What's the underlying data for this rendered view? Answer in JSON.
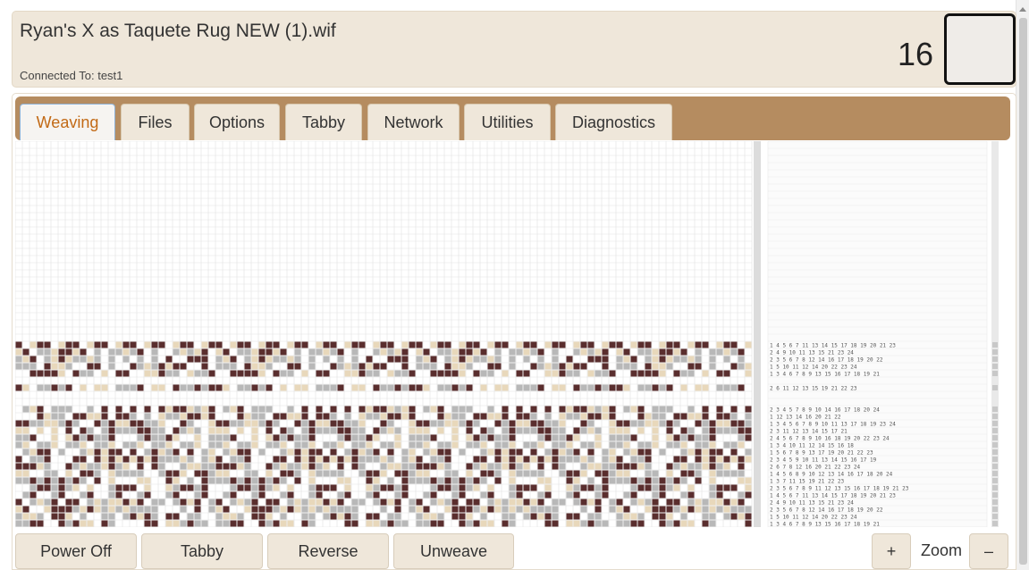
{
  "header": {
    "file_title": "Ryan's X as Taquete Rug NEW (1).wif",
    "connection": "Connected To: test1",
    "pick_counter": "16",
    "swatch_color": "#efece8"
  },
  "tabs": [
    {
      "label": "Weaving",
      "active": true
    },
    {
      "label": "Files",
      "active": false
    },
    {
      "label": "Options",
      "active": false
    },
    {
      "label": "Tabby",
      "active": false
    },
    {
      "label": "Network",
      "active": false
    },
    {
      "label": "Utilities",
      "active": false
    },
    {
      "label": "Diagnostics",
      "active": false
    }
  ],
  "footer": {
    "power_off": "Power Off",
    "tabby": "Tabby",
    "reverse": "Reverse",
    "unweave": "Unweave",
    "zoom_in": "+",
    "zoom_label": "Zoom",
    "zoom_out": "–"
  },
  "colors": {
    "accent": "#c26a16",
    "tabbar": "#b58c60",
    "panel": "#efe7da",
    "thread_dark": "#5a2e2e",
    "thread_tan": "#e8d8bb",
    "thread_gray": "#b8b8b8",
    "thread_white": "#ffffff"
  },
  "draft": {
    "rows": [
      {
        "lifts": "1  4 5 6 7  11  13 14 15  17 18 19 20 21  23"
      },
      {
        "lifts": "2  4  9 10 11  13  15  21  23 24"
      },
      {
        "lifts": "2 3  5 6 7 8  12  14  16 17 18 19 20  22"
      },
      {
        "lifts": "1  5  10 11 12  14  20  22 23 24"
      },
      {
        "lifts": "1  3 4  6 7 8 9  13  15 16 17 18 19  21"
      },
      {
        "lifts": "2  6  11 12 13  15  19  21 22 23"
      },
      {
        "lifts": "2 3 4 5  7 8 9 10  14  16 17 18  20  24"
      },
      {
        "lifts": "1  12 13 14  16  20 21 22"
      },
      {
        "lifts": "1  3 4 5 6 7 8 9 10 11  13  17 18 19  23 24"
      },
      {
        "lifts": "2 3  11 12 13 14 15  17  21"
      },
      {
        "lifts": "2  4 5 6 7 8 9 10  16  18 19 20  22 23 24"
      },
      {
        "lifts": "1  3 4  10 11 12  14 15 16  18"
      },
      {
        "lifts": "1  5 6 7 8 9  13  17  19 20 21 22 23"
      },
      {
        "lifts": "2 3 4 5  9 10 11  13 14 15 16 17  19"
      },
      {
        "lifts": "2  6 7 8  12  16  20 21 22 23 24"
      },
      {
        "lifts": "1  4 5 6  8 9 10  12 13 14  16 17 18  20  24"
      },
      {
        "lifts": "1  3  7  11  15  19  21 22 23"
      },
      {
        "lifts": "2 3  5 6 7 8 9  11 12 13  15 16 17 18 19  21  23"
      }
    ]
  }
}
